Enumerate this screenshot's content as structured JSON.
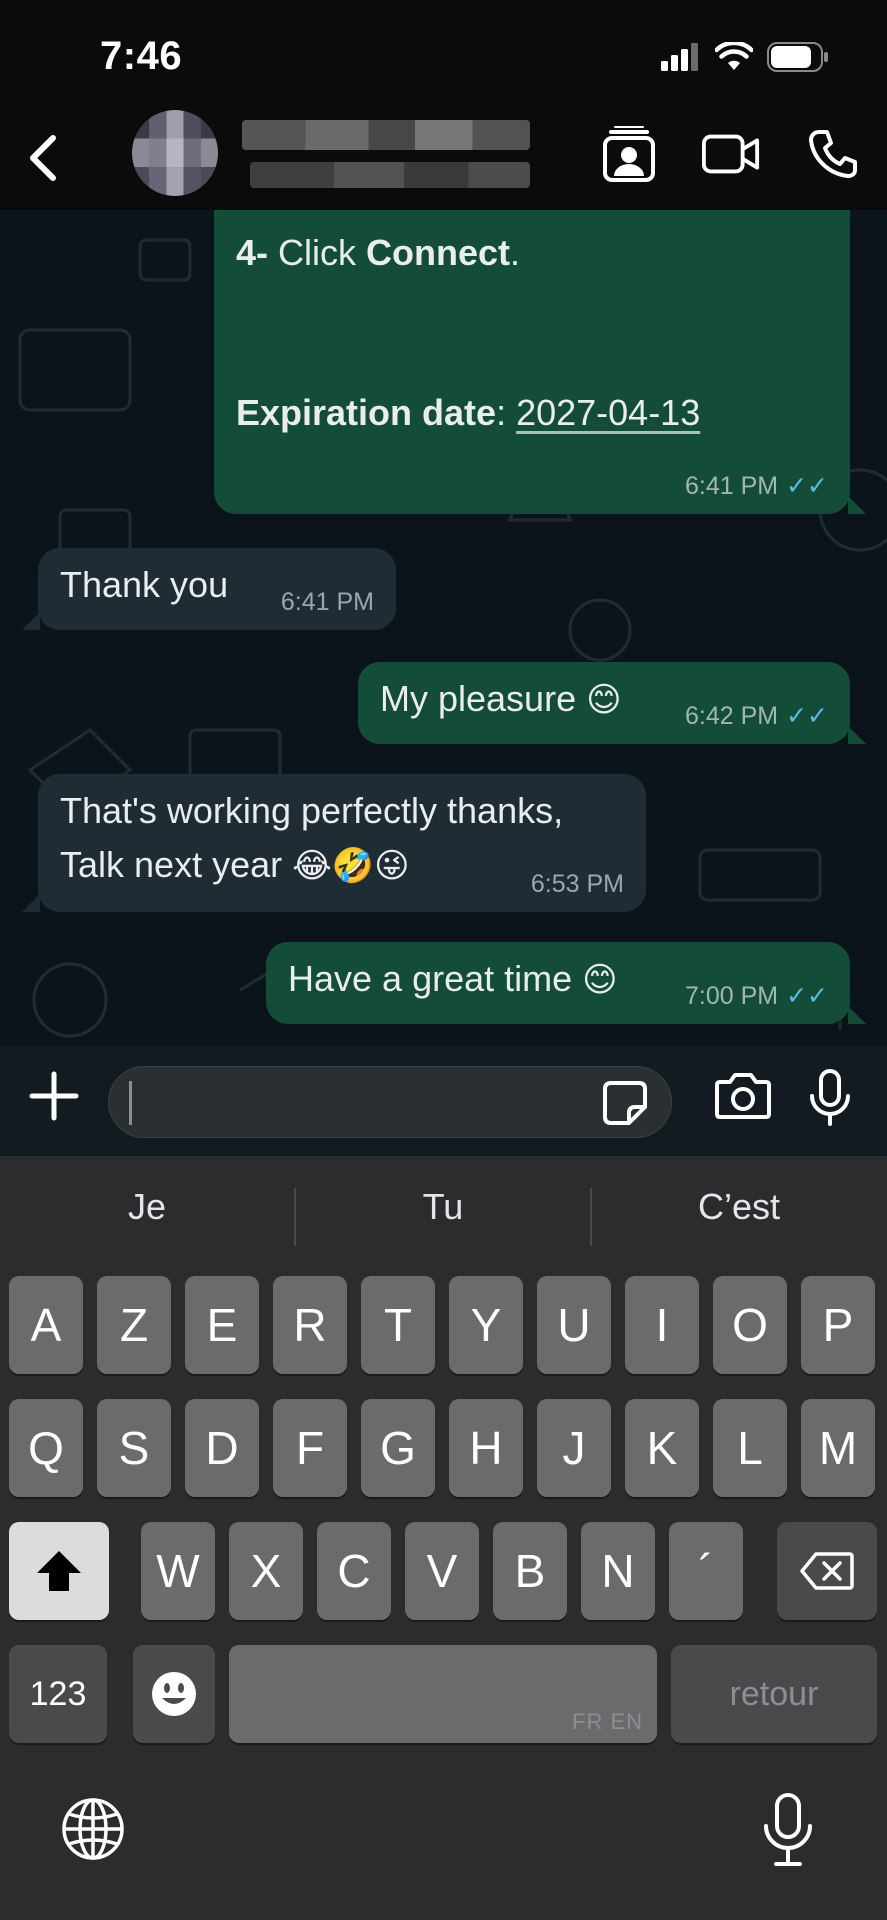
{
  "status_bar": {
    "time": "7:46"
  },
  "header": {
    "back": "back",
    "contact_name": "",
    "contact_status": ""
  },
  "messages": [
    {
      "dir": "out",
      "line1_prefix": "4-",
      "line1_mid": " Click ",
      "line1_bold": "Connect",
      "line1_suffix": ".",
      "line2_label": "Expiration date",
      "line2_sep": ": ",
      "line2_value": "2027-04-13",
      "time": "6:41 PM",
      "ticks": "✓✓"
    },
    {
      "dir": "in",
      "text": "Thank you",
      "time": "6:41 PM"
    },
    {
      "dir": "out",
      "text": "My pleasure",
      "emoji": "😊",
      "time": "6:42 PM",
      "ticks": "✓✓"
    },
    {
      "dir": "in",
      "line1": "That's working perfectly thanks,",
      "line2": "Talk next year",
      "emoji": "😂🤣😜",
      "time": "6:53 PM"
    },
    {
      "dir": "out",
      "text": "Have a great time",
      "emoji": "😊",
      "time": "7:00 PM",
      "ticks": "✓✓"
    }
  ],
  "composer": {
    "value": "",
    "placeholder": ""
  },
  "keyboard": {
    "suggestions": [
      "Je",
      "Tu",
      "C’est"
    ],
    "row1": [
      "A",
      "Z",
      "E",
      "R",
      "T",
      "Y",
      "U",
      "I",
      "O",
      "P"
    ],
    "row2": [
      "Q",
      "S",
      "D",
      "F",
      "G",
      "H",
      "J",
      "K",
      "L",
      "M"
    ],
    "row3": [
      "W",
      "X",
      "C",
      "V",
      "B",
      "N",
      "´"
    ],
    "numbers_key": "123",
    "space_hint": "FR EN",
    "return_key": "retour"
  },
  "colors": {
    "outgoing_bubble": "#144d37",
    "incoming_bubble": "#202c33",
    "chat_bg": "#0b141a",
    "read_ticks": "#53bdeb"
  }
}
